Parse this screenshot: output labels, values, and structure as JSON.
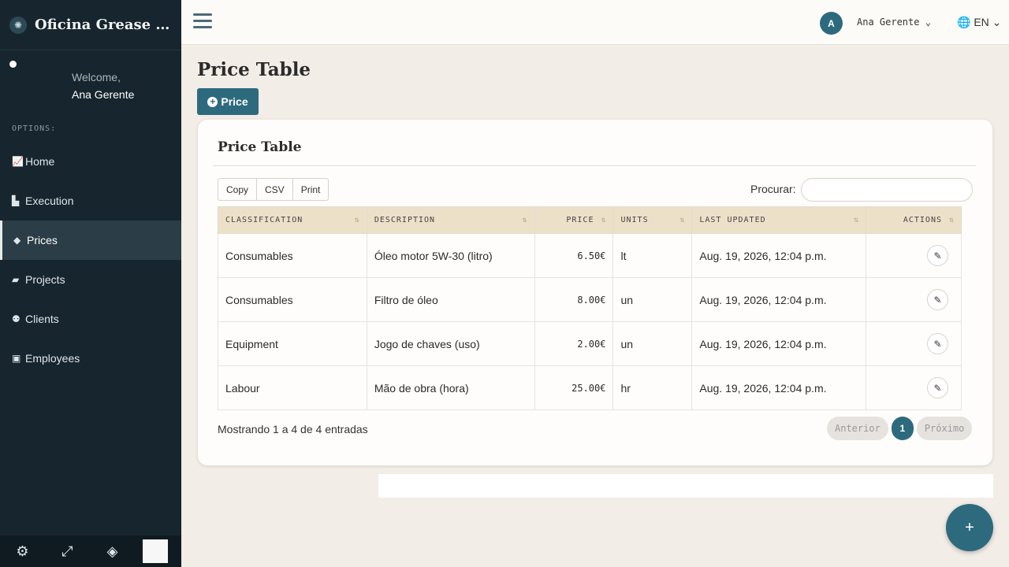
{
  "brand": {
    "title": "Oficina Grease M...",
    "logo_icon": "gear-logo-icon"
  },
  "user_panel": {
    "welcome": "Welcome,",
    "name": "Ana Gerente"
  },
  "sidebar": {
    "options_title": "OPTIONS:",
    "items": [
      {
        "label": "Home",
        "icon": "chart-line-icon",
        "active": false
      },
      {
        "label": "Execution",
        "icon": "industry-icon",
        "active": false
      },
      {
        "label": "Prices",
        "icon": "tags-icon",
        "active": true
      },
      {
        "label": "Projects",
        "icon": "folder-open-icon",
        "active": false
      },
      {
        "label": "Clients",
        "icon": "users-icon",
        "active": false
      },
      {
        "label": "Employees",
        "icon": "id-badge-icon",
        "active": false
      }
    ],
    "footer_icons": [
      "gear-icon",
      "expand-icon",
      "eye-slash-icon"
    ]
  },
  "topbar": {
    "avatar_letter": "A",
    "user_name": "Ana Gerente",
    "language": "EN"
  },
  "page": {
    "title": "Price Table",
    "add_button": "Price"
  },
  "card": {
    "title": "Price Table",
    "export_buttons": [
      "Copy",
      "CSV",
      "Print"
    ],
    "search_label": "Procurar:",
    "search_value": "",
    "columns": [
      "CLASSIFICATION",
      "DESCRIPTION",
      "PRICE",
      "UNITS",
      "LAST UPDATED",
      "ACTIONS"
    ],
    "rows": [
      {
        "classification": "Consumables",
        "description": "Óleo motor 5W-30 (litro)",
        "price": "6.50€",
        "units": "lt",
        "updated": "Aug. 19, 2026, 12:04 p.m."
      },
      {
        "classification": "Consumables",
        "description": "Filtro de óleo",
        "price": "8.00€",
        "units": "un",
        "updated": "Aug. 19, 2026, 12:04 p.m."
      },
      {
        "classification": "Equipment",
        "description": "Jogo de chaves (uso)",
        "price": "2.00€",
        "units": "un",
        "updated": "Aug. 19, 2026, 12:04 p.m."
      },
      {
        "classification": "Labour",
        "description": "Mão de obra (hora)",
        "price": "25.00€",
        "units": "hr",
        "updated": "Aug. 19, 2026, 12:04 p.m."
      }
    ],
    "info": "Mostrando 1 a 4 de 4 entradas",
    "pagination": {
      "previous": "Anterior",
      "current": "1",
      "next": "Próximo"
    }
  },
  "fab": {
    "label": "+"
  },
  "colors": {
    "sidebar": "#17262e",
    "accent": "#2e6a7e",
    "header_row": "#ede0c9",
    "background": "#f2ede6"
  }
}
